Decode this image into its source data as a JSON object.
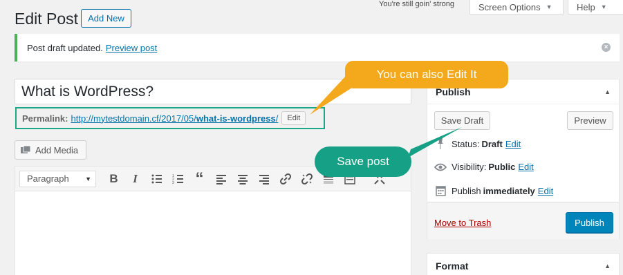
{
  "header": {
    "tagline": "You're still goin' strong",
    "screen_options": "Screen Options",
    "help": "Help"
  },
  "page": {
    "title": "Edit Post",
    "add_new": "Add New"
  },
  "notice": {
    "message": "Post draft updated.",
    "link": "Preview post",
    "accent_color": "#46b450"
  },
  "post": {
    "title": "What is WordPress?",
    "permalink_label": "Permalink:",
    "permalink_base": "http://mytestdomain.cf/2017/05/",
    "permalink_slug": "what-is-wordpress",
    "permalink_end": "/",
    "edit_button": "Edit"
  },
  "media": {
    "add_media": "Add Media"
  },
  "toolbar": {
    "format_select": "Paragraph",
    "buttons": [
      "bold-icon",
      "italic-icon",
      "bullet-list-icon",
      "numbered-list-icon",
      "blockquote-icon",
      "align-left-icon",
      "align-center-icon",
      "align-right-icon",
      "link-icon",
      "unlink-icon",
      "read-more-icon",
      "toolbar-toggle-icon",
      "fullscreen-icon"
    ]
  },
  "publish_box": {
    "title": "Publish",
    "save_draft": "Save Draft",
    "preview": "Preview",
    "status_label": "Status:",
    "status_value": "Draft",
    "visibility_label": "Visibility:",
    "visibility_value": "Public",
    "publish_label": "Publish",
    "publish_value": "immediately",
    "edit": "Edit",
    "move_to_trash": "Move to Trash",
    "publish_button": "Publish",
    "primary_color": "#0085ba"
  },
  "format_box": {
    "title": "Format"
  },
  "annotations": {
    "edit_callout": "You can also Edit It",
    "save_callout": "Save post",
    "edit_color": "#f4a81c",
    "save_color": "#16a085"
  }
}
